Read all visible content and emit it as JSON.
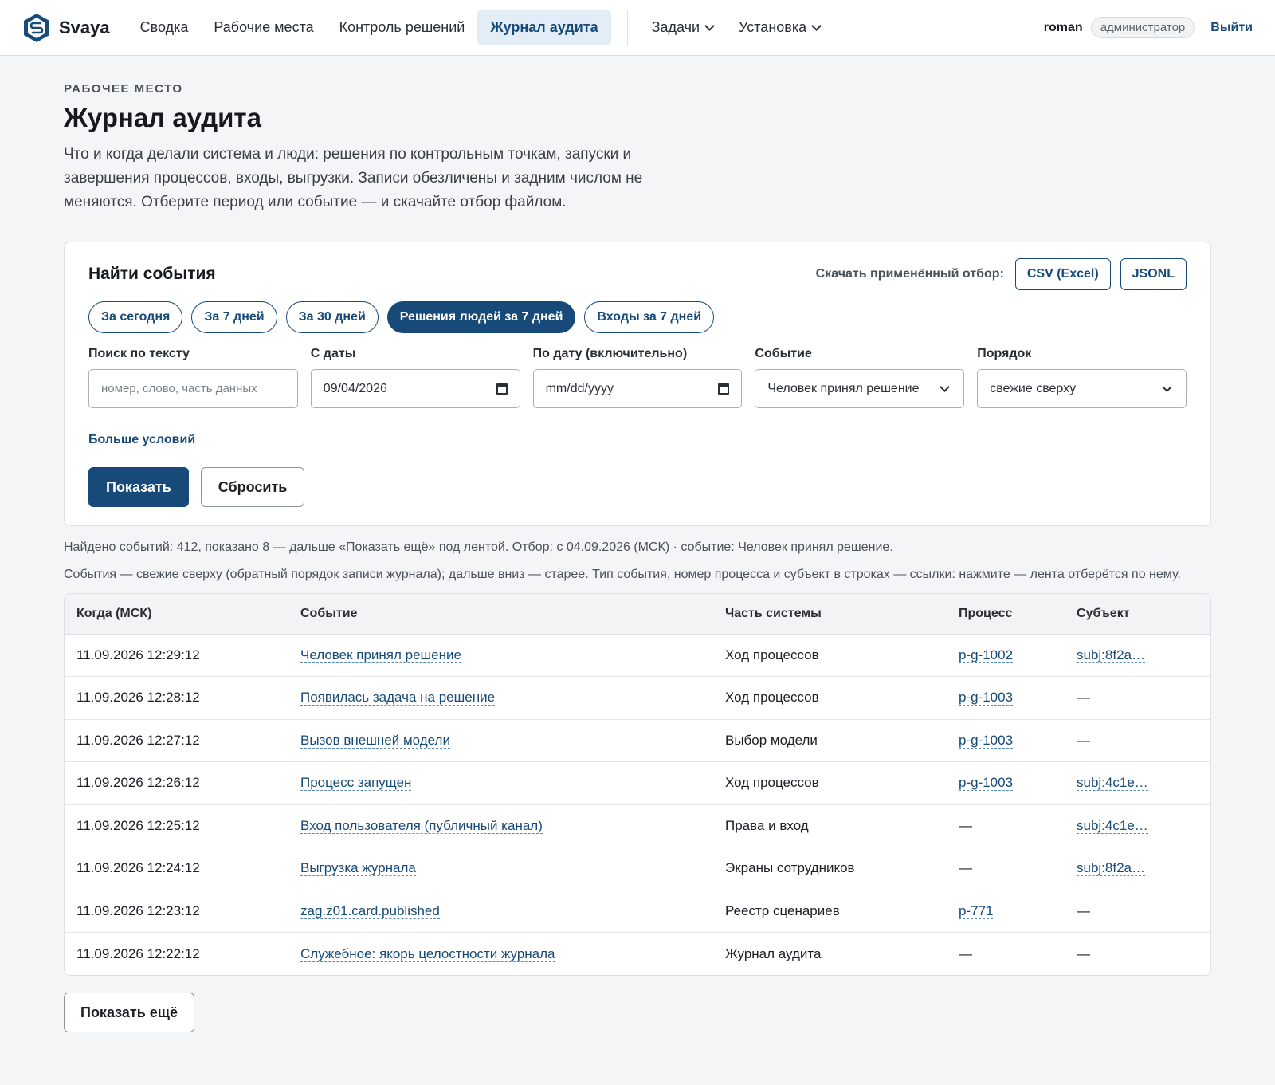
{
  "brand": {
    "name": "Svaya"
  },
  "nav": {
    "items": [
      "Сводка",
      "Рабочие места",
      "Контроль решений",
      "Журнал аудита"
    ],
    "dropdowns": [
      "Задачи",
      "Установка"
    ]
  },
  "user": {
    "name": "roman",
    "role": "администратор",
    "logout": "Выйти"
  },
  "header": {
    "eyebrow": "РАБОЧЕЕ МЕСТО",
    "title": "Журнал аудита",
    "description": "Что и когда делали система и люди: решения по контрольным точкам, запуски и завершения процессов, входы, выгрузки. Записи обезличены и задним числом не меняются. Отберите период или событие — и скачайте отбор файлом."
  },
  "filter": {
    "title": "Найти события",
    "download_label": "Скачать применённый отбор:",
    "download_csv": "CSV (Excel)",
    "download_jsonl": "JSONL",
    "presets": [
      "За сегодня",
      "За 7 дней",
      "За 30 дней",
      "Решения людей за 7 дней",
      "Входы за 7 дней"
    ],
    "active_preset": "Решения людей за 7 дней",
    "fields": {
      "search": {
        "label": "Поиск по тексту",
        "placeholder": "номер, слово, часть данных",
        "value": ""
      },
      "date_from": {
        "label": "С даты",
        "value": "09/04/2026"
      },
      "date_to": {
        "label": "По дату (включительно)",
        "placeholder": "mm/dd/yyyy",
        "value": ""
      },
      "event": {
        "label": "Событие",
        "value": "Человек принял решение"
      },
      "order": {
        "label": "Порядок",
        "value": "свежие сверху"
      }
    },
    "more_conditions": "Больше условий",
    "show": "Показать",
    "reset": "Сбросить"
  },
  "meta": {
    "found": "Найдено событий: 412, показано 8 — дальше «Показать ещё» под лентой. Отбор: с 04.09.2026 (МСК) · событие: Человек принял решение.",
    "hint": "События — свежие сверху (обратный порядок записи журнала); дальше вниз — старее. Тип события, номер процесса и субъект в строках — ссылки: нажмите — лента отберётся по нему."
  },
  "table": {
    "headers": [
      "Когда (МСК)",
      "Событие",
      "Часть системы",
      "Процесс",
      "Субъект"
    ],
    "rows": [
      {
        "when": "11.09.2026 12:29:12",
        "event": "Человек принял решение",
        "part": "Ход процессов",
        "process": "p-g-1002",
        "subject": "subj:8f2a…"
      },
      {
        "when": "11.09.2026 12:28:12",
        "event": "Появилась задача на решение",
        "part": "Ход процессов",
        "process": "p-g-1003",
        "subject": "—"
      },
      {
        "when": "11.09.2026 12:27:12",
        "event": "Вызов внешней модели",
        "part": "Выбор модели",
        "process": "p-g-1003",
        "subject": "—"
      },
      {
        "when": "11.09.2026 12:26:12",
        "event": "Процесс запущен",
        "part": "Ход процессов",
        "process": "p-g-1003",
        "subject": "subj:4c1e…"
      },
      {
        "when": "11.09.2026 12:25:12",
        "event": "Вход пользователя (публичный канал)",
        "part": "Права и вход",
        "process": "—",
        "subject": "subj:4c1e…"
      },
      {
        "when": "11.09.2026 12:24:12",
        "event": "Выгрузка журнала",
        "part": "Экраны сотрудников",
        "process": "—",
        "subject": "subj:8f2a…"
      },
      {
        "when": "11.09.2026 12:23:12",
        "event": "zag.z01.card.published",
        "part": "Реестр сценариев",
        "process": "p-771",
        "subject": "—"
      },
      {
        "when": "11.09.2026 12:22:12",
        "event": "Служебное: якорь целостности журнала",
        "part": "Журнал аудита",
        "process": "—",
        "subject": "—"
      }
    ]
  },
  "show_more": "Показать ещё",
  "colors": {
    "accent": "#174a78",
    "active_nav_bg": "#e3edf7",
    "page_bg": "#f4f5f7"
  }
}
